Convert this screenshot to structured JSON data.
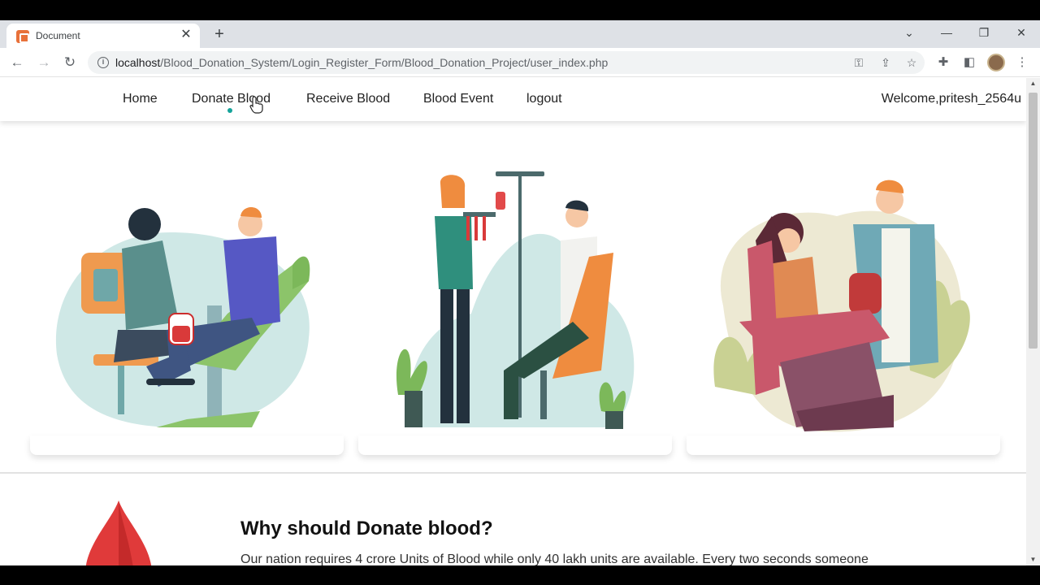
{
  "browser": {
    "tab_title": "Document",
    "url_host": "localhost",
    "url_path": "/Blood_Donation_System/Login_Register_Form/Blood_Donation_Project/user_index.php"
  },
  "nav": {
    "items": [
      {
        "label": "Home"
      },
      {
        "label": "Donate Blood"
      },
      {
        "label": "Receive Blood"
      },
      {
        "label": "Blood Event"
      },
      {
        "label": "logout"
      }
    ],
    "welcome": "Welcome,pritesh_2564u"
  },
  "section": {
    "title": "Why should Donate blood?",
    "text": "Our nation requires 4 crore Units of Blood while only 40 lakh units are available. Every two seconds someone"
  },
  "colors": {
    "accent": "#14a39a",
    "blood_red": "#e03a3a"
  },
  "icons": [
    "info-icon",
    "key-icon",
    "share-icon",
    "star-icon",
    "extensions-icon",
    "sidebar-icon",
    "menu-icon"
  ]
}
